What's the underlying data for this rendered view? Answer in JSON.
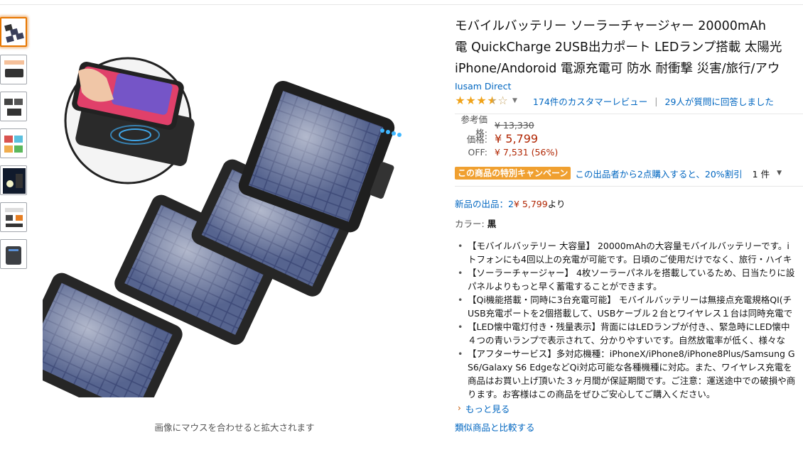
{
  "product": {
    "title_lines": [
      "モバイルバッテリー ソーラーチャージャー 20000mAh",
      "電 QuickCharge 2USB出力ポート LEDランプ搭載 太陽光",
      "iPhone/Andoroid 電源充電可 防水 耐衝撃 災害/旅行/アウ"
    ],
    "brand": "Iusam Direct",
    "rating_stars": 4,
    "reviews_link": "174件のカスタマーレビュー",
    "separator": "|",
    "questions_link": "29人が質問に回答しました"
  },
  "pricing": {
    "list_label": "参考価格:",
    "list_price": "¥ 13,330",
    "price_label": "価格:",
    "price": "¥ 5,799",
    "off_label": "OFF:",
    "savings": "¥ 7,531 (56%)"
  },
  "promotion": {
    "badge": "この商品の特別キャンペーン",
    "text": "この出品者から2点購入すると、20%割引",
    "qty": "1 件"
  },
  "offers": {
    "prefix": "新品の出品：2",
    "price": "¥ 5,799",
    "suffix": "より"
  },
  "color": {
    "label": "カラー: ",
    "value": "黒"
  },
  "bullets": [
    [
      "【モバイルバッテリー 大容量】 20000mAhの大容量モバイルバッテリーです。i",
      "トフォンにも4回以上の充電が可能です。日頃のご使用だけでなく、旅行・ハイキ"
    ],
    [
      "【ソーラーチャージャー】 4枚ソーラーパネルを搭載しているため、日当たりに設",
      "パネルよりもっと早く蓄電することができます。"
    ],
    [
      "【Qi機能搭載・同時に3台充電可能】 モバイルバッテリーは無接点充電規格QI(チ",
      "USB充電ポートを2個搭載して、USBケーブル２台とワイヤレス１台は同時充電で"
    ],
    [
      "【LED懐中電灯付き・残量表示】背面にはLEDランプが付き、、緊急時にLED懐中",
      "４つの青いランプで表示されて、分かりやすいです。自然放電率が低く、様々な"
    ],
    [
      "【アフターサービス】多対応機種：iPhoneX/iPhone8/iPhone8Plus/Samsung G",
      "S6/Galaxy S6 EdgeなどQi対応可能な各種機種に対応。また、ワイヤレス充電を",
      "商品はお買い上げ頂いた３ヶ月間が保証期間です。ご注意：運送途中での破損や商",
      "ります。お客様はこの商品をぜひご安心してご購入ください。"
    ]
  ],
  "more_link": "もっと見る",
  "hover_hint": "画像にマウスを合わせると拡大されます",
  "compare_link": "類似商品と比較する",
  "colors": {
    "link": "#0066c0",
    "price": "#b12704",
    "star": "#f0a31a",
    "badge": "#f0a030",
    "thumb_active": "#e77600"
  },
  "thumbnails": [
    "solar-panel-product",
    "power-bank-side",
    "solar-panel-folded",
    "colorful-features",
    "led-flashlight",
    "infographic",
    "power-bank-dark"
  ]
}
